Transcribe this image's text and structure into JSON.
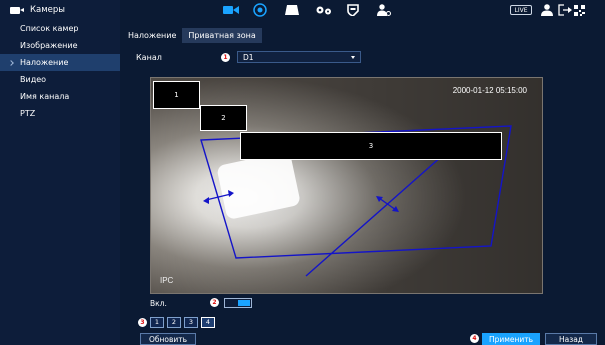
{
  "sidebar": {
    "header": "Камеры",
    "items": [
      {
        "label": "Список камер"
      },
      {
        "label": "Изображение"
      },
      {
        "label": "Наложение"
      },
      {
        "label": "Видео"
      },
      {
        "label": "Имя канала"
      },
      {
        "label": "PTZ"
      }
    ],
    "active_index": 2
  },
  "topbar": {
    "live_label": "LIVE",
    "icons": [
      "camera-icon",
      "network-icon",
      "storage-icon",
      "settings-icon",
      "shield-icon",
      "user-settings-icon",
      "user-icon",
      "logout-icon",
      "qr-icon"
    ]
  },
  "tabs": [
    {
      "label": "Наложение"
    },
    {
      "label": "Приватная зона"
    }
  ],
  "active_tab": 1,
  "channel": {
    "label": "Канал",
    "value": "D1",
    "badge": "1"
  },
  "video": {
    "timestamp": "2000-01-12 05:15:00",
    "overlay_text": "IPC",
    "masks": [
      {
        "label": "1"
      },
      {
        "label": "2"
      },
      {
        "label": "3"
      }
    ]
  },
  "enable": {
    "label": "Вкл.",
    "badge": "2",
    "on": true
  },
  "zones": {
    "badge": "3",
    "items": [
      "1",
      "2",
      "3",
      "4"
    ],
    "active_index": 3
  },
  "buttons": {
    "refresh": "Обновить",
    "apply": "Применить",
    "apply_badge": "4",
    "back": "Назад"
  },
  "colors": {
    "background": "#0b1a33",
    "sidebar": "#0d1d3a",
    "active_item": "#1f3f6d",
    "accent": "#1aa3ff",
    "badge_text": "#dd1111"
  }
}
